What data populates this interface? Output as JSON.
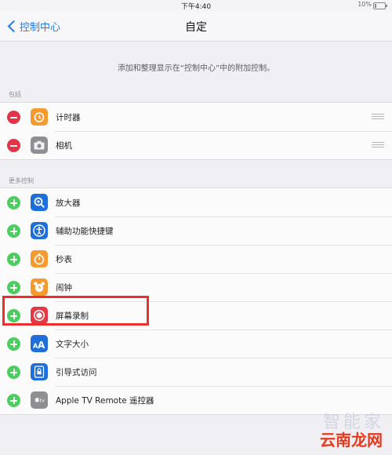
{
  "status_bar": {
    "time": "下午4:40",
    "battery": "10%"
  },
  "nav": {
    "back_label": "控制中心",
    "title": "自定"
  },
  "description": "添加和整理显示在“控制中心”中的附加控制。",
  "sections": {
    "included": {
      "header": "包括",
      "items": [
        {
          "label": "计时器",
          "icon": "timer-icon",
          "color": "#f59a2e"
        },
        {
          "label": "相机",
          "icon": "camera-icon",
          "color": "#8e8e93"
        }
      ]
    },
    "more": {
      "header": "更多控制",
      "items": [
        {
          "label": "放大器",
          "icon": "magnifier-icon",
          "color": "#1f6fd8"
        },
        {
          "label": "辅助功能快捷键",
          "icon": "accessibility-icon",
          "color": "#1f6fd8"
        },
        {
          "label": "秒表",
          "icon": "stopwatch-icon",
          "color": "#f59a2e"
        },
        {
          "label": "闹钟",
          "icon": "alarm-icon",
          "color": "#f59a2e"
        },
        {
          "label": "屏幕录制",
          "icon": "screen-record-icon",
          "color": "#e33846"
        },
        {
          "label": "文字大小",
          "icon": "text-size-icon",
          "color": "#1f6fd8"
        },
        {
          "label": "引导式访问",
          "icon": "guided-access-icon",
          "color": "#1f6fd8"
        },
        {
          "label": "Apple TV Remote 遥控器",
          "icon": "apple-tv-remote-icon",
          "color": "#8e8e93"
        }
      ]
    }
  },
  "watermark": {
    "text": "智能家",
    "logo": "云南龙网"
  },
  "accent_colors": {
    "add": "#4ccd5f",
    "remove": "#e3344a",
    "highlight": "#ee2d2d",
    "link": "#1a7cf5"
  }
}
